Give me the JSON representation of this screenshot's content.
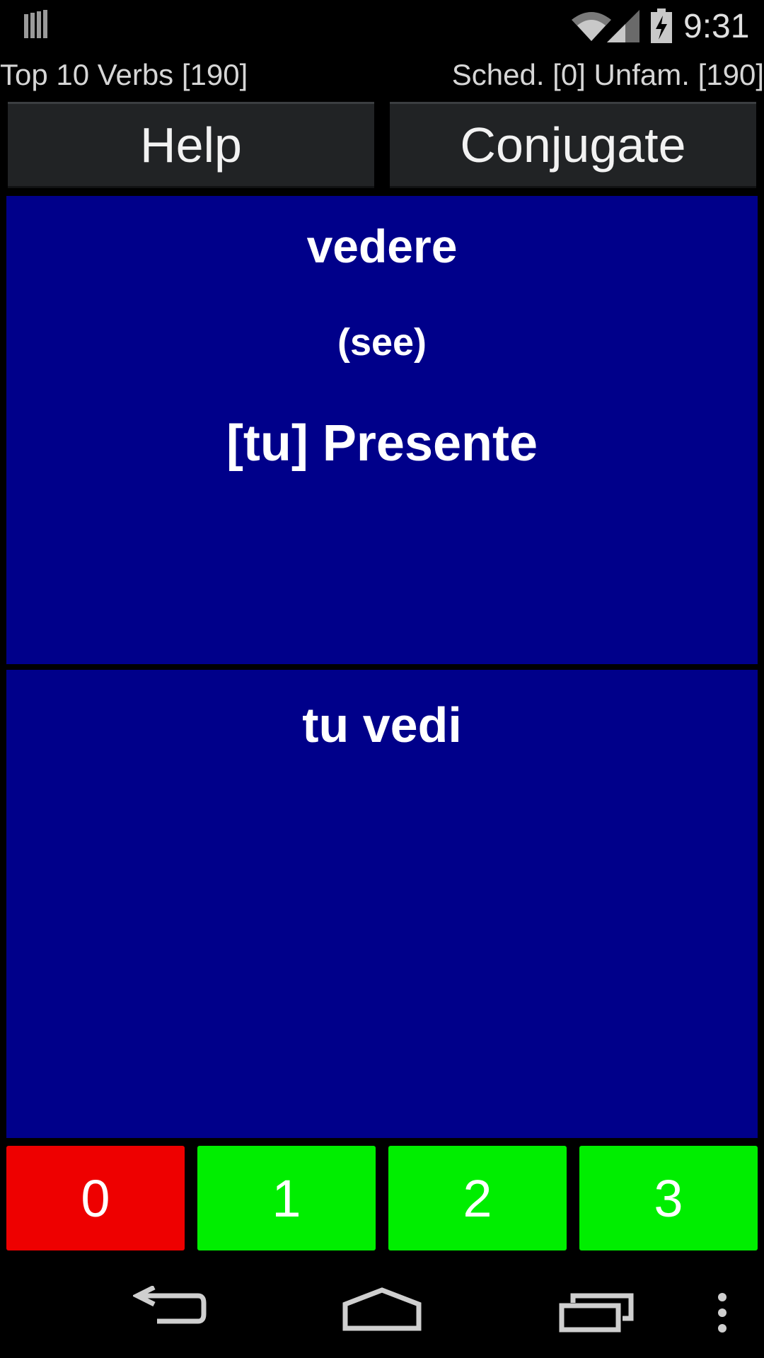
{
  "status_bar": {
    "time": "9:31",
    "icons": [
      "notification-icon",
      "wifi-icon",
      "signal-icon",
      "battery-charging-icon"
    ]
  },
  "header": {
    "deck_title": "Top 10 Verbs [190]",
    "sched_info": "Sched. [0] Unfam. [190]"
  },
  "toolbar": {
    "help_label": "Help",
    "conjugate_label": "Conjugate"
  },
  "question": {
    "infinitive": "vedere",
    "translation": "(see)",
    "form_prompt": "[tu] Presente"
  },
  "answer": {
    "text": "tu vedi"
  },
  "grades": [
    {
      "label": "0",
      "color": "#ee0000"
    },
    {
      "label": "1",
      "color": "#00ee00"
    },
    {
      "label": "2",
      "color": "#00ee00"
    },
    {
      "label": "3",
      "color": "#00ee00"
    }
  ],
  "colors": {
    "card_background": "#00008a",
    "button_background": "#212325",
    "page_background": "#000000"
  },
  "nav_bar": {
    "icons": [
      "back-icon",
      "home-icon",
      "recents-icon",
      "overflow-menu-icon"
    ]
  }
}
